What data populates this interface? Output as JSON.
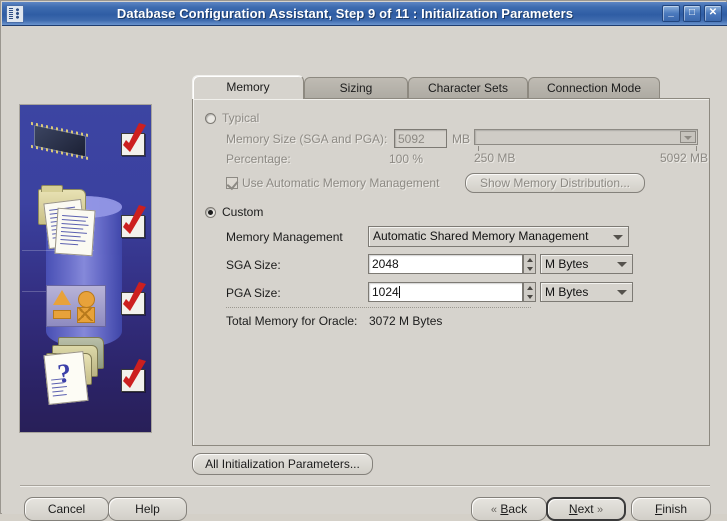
{
  "window": {
    "title": "Database Configuration Assistant, Step 9 of 11 : Initialization Parameters",
    "icon": "database-assistant-icon",
    "minimize": "_",
    "maximize": "□",
    "close": "✕"
  },
  "tabs": [
    {
      "label": "Memory",
      "active": true
    },
    {
      "label": "Sizing",
      "active": false
    },
    {
      "label": "Character Sets",
      "active": false
    },
    {
      "label": "Connection Mode",
      "active": false
    }
  ],
  "memory_tab": {
    "typical": {
      "radio_label": "Typical",
      "selected": false,
      "memory_size_label": "Memory Size (SGA and PGA):",
      "memory_size_value": "5092",
      "memory_size_unit": "MB",
      "percentage_label": "Percentage:",
      "percentage_value": "100 %",
      "slider_min_label": "250 MB",
      "slider_max_label": "5092 MB",
      "amm_checkbox_label": "Use Automatic Memory Management",
      "amm_checked": true,
      "show_distribution_button": "Show Memory Distribution..."
    },
    "custom": {
      "radio_label": "Custom",
      "selected": true,
      "memory_management_label": "Memory Management",
      "memory_management_value": "Automatic Shared Memory Management",
      "sga_label": "SGA Size:",
      "sga_value": "2048",
      "sga_unit": "M Bytes",
      "pga_label": "PGA Size:",
      "pga_value": "1024",
      "pga_unit": "M Bytes",
      "total_label": "Total Memory for Oracle:",
      "total_value": "3072 M Bytes"
    }
  },
  "all_params_button": "All Initialization Parameters...",
  "footer": {
    "cancel": "Cancel",
    "help": "Help",
    "back": "Back",
    "back_mnemonic": "B",
    "next": "Next",
    "next_mnemonic": "N",
    "finish": "Finish",
    "finish_mnemonic": "F",
    "back_arrow": "«",
    "next_arrow": "»"
  },
  "illustration": {
    "alt": "database-wizard-illustration",
    "checkmarks": 4,
    "question_mark": "?"
  },
  "colors": {
    "titlebar": "#2f5da4",
    "panel": "#d6d3cd",
    "illustration_top": "#3c45a2",
    "illustration_bottom": "#281f58",
    "checkmark": "#cc1f1f",
    "accent_folder": "#d6cf96"
  }
}
